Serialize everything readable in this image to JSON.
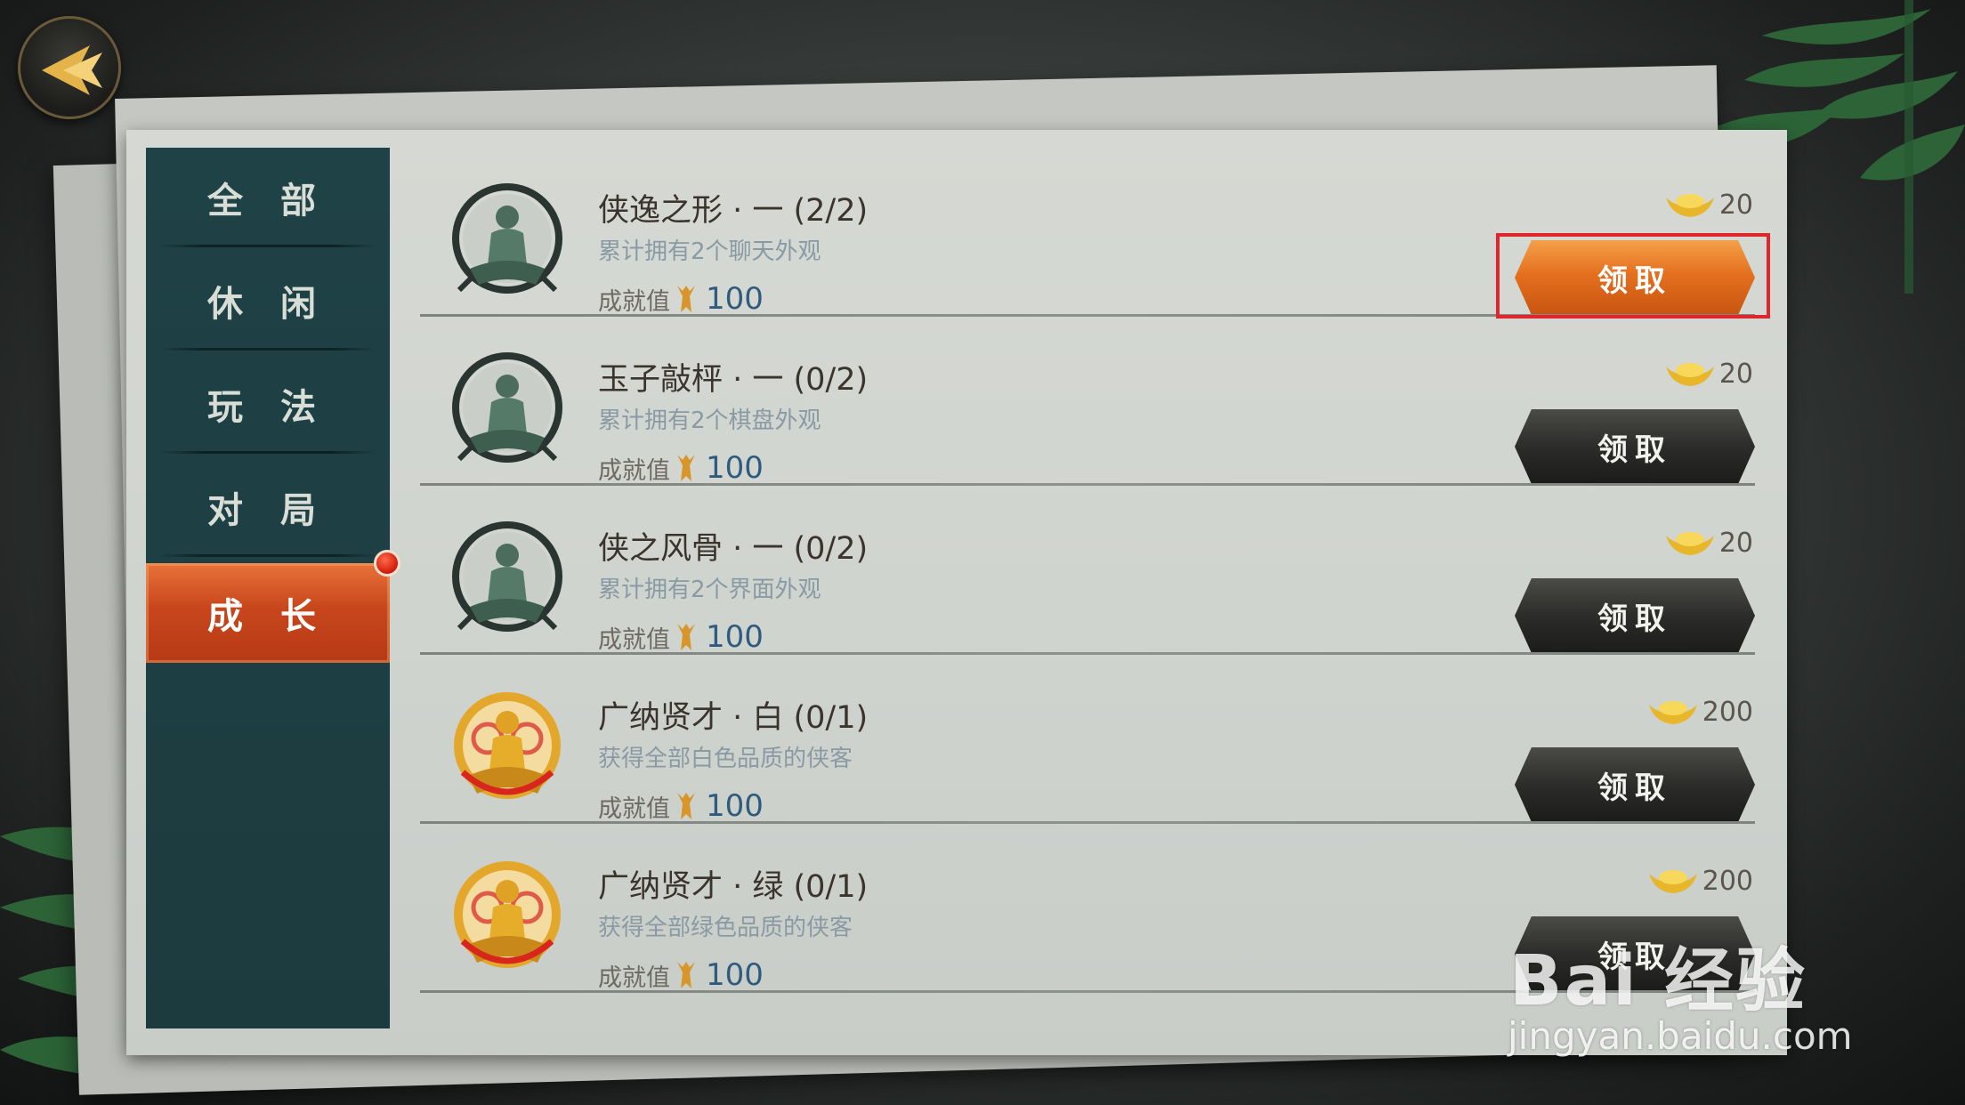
{
  "sidebar": {
    "items": [
      {
        "label": "全 部"
      },
      {
        "label": "休 闲"
      },
      {
        "label": "玩 法"
      },
      {
        "label": "对 局"
      },
      {
        "label": "成 长",
        "active": true
      }
    ]
  },
  "achievements": [
    {
      "title": "侠逸之形 · 一 (2/2)",
      "desc": "累计拥有2个聊天外观",
      "score_label": "成就值",
      "score": "100",
      "reward": "20",
      "button": "领取",
      "button_state": "claimable",
      "medal": "jade"
    },
    {
      "title": "玉子敲枰 · 一 (0/2)",
      "desc": "累计拥有2个棋盘外观",
      "score_label": "成就值",
      "score": "100",
      "reward": "20",
      "button": "领取",
      "button_state": "locked",
      "medal": "jade"
    },
    {
      "title": "侠之风骨 · 一 (0/2)",
      "desc": "累计拥有2个界面外观",
      "score_label": "成就值",
      "score": "100",
      "reward": "20",
      "button": "领取",
      "button_state": "locked",
      "medal": "jade"
    },
    {
      "title": "广纳贤才 · 白 (0/1)",
      "desc": "获得全部白色品质的侠客",
      "score_label": "成就值",
      "score": "100",
      "reward": "200",
      "button": "领取",
      "button_state": "locked",
      "medal": "gold"
    },
    {
      "title": "广纳贤才 · 绿 (0/1)",
      "desc": "获得全部绿色品质的侠客",
      "score_label": "成就值",
      "score": "100",
      "reward": "200",
      "button": "领取",
      "button_state": "locked",
      "medal": "gold"
    }
  ],
  "watermark": {
    "logo": "Bai 经验",
    "url": "jingyan.baidu.com"
  },
  "colors": {
    "accent_orange": "#e4701f",
    "highlight_red": "#e0262c",
    "sidebar": "#1f4246"
  }
}
